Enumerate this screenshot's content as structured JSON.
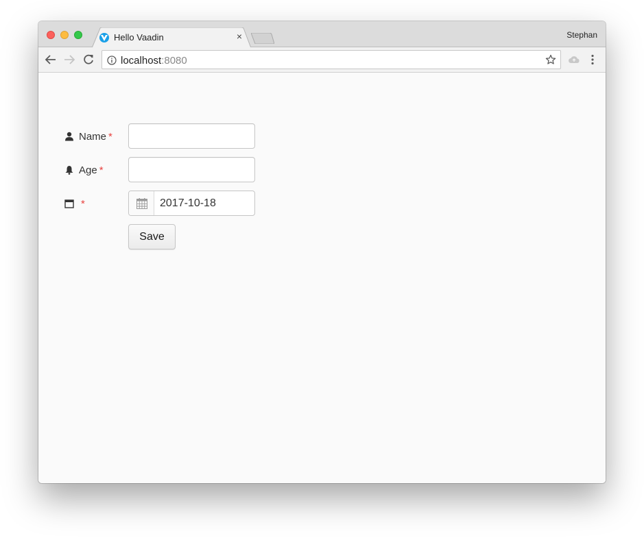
{
  "browser": {
    "tab": {
      "title": "Hello Vaadin",
      "close_glyph": "×"
    },
    "profile_name": "Stephan",
    "address": {
      "host": "localhost",
      "port": ":8080"
    },
    "icons": {
      "back": "arrow-left-icon",
      "forward": "arrow-right-icon",
      "reload": "reload-icon",
      "info": "info-icon",
      "star": "star-icon",
      "drive": "cloud-icon",
      "menu": "kebab-menu-icon"
    }
  },
  "form": {
    "name": {
      "label": "Name",
      "required_mark": "*",
      "value": "",
      "icon": "user-icon"
    },
    "age": {
      "label": "Age",
      "required_mark": "*",
      "value": "",
      "icon": "bell-icon"
    },
    "date": {
      "label": "",
      "required_mark": "*",
      "value": "2017-10-18",
      "icon": "calendar-icon"
    },
    "save_label": "Save"
  },
  "colors": {
    "required": "#e8423f",
    "vaadin_blue": "#1aa0e8",
    "traffic_close": "#fc605c",
    "traffic_min": "#fdbc40",
    "traffic_max": "#34c84a"
  }
}
